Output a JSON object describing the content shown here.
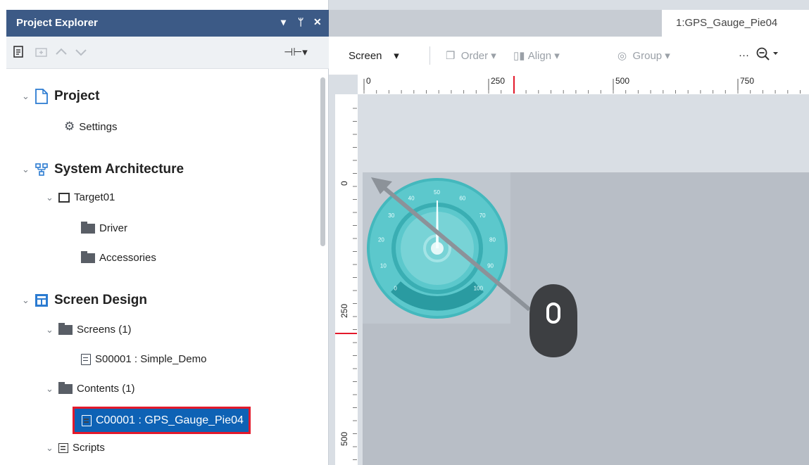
{
  "explorer": {
    "title": "Project Explorer",
    "header_controls": [
      "▾",
      "ᛘ",
      "✕"
    ],
    "toolbar": {
      "pin_label": "⊣⊢▾"
    },
    "tree": {
      "project": "Project",
      "settings": "Settings",
      "system_architecture": "System Architecture",
      "target": "Target01",
      "driver": "Driver",
      "accessories": "Accessories",
      "screen_design": "Screen Design",
      "screens": "Screens (1)",
      "screen_item": "S00001 : Simple_Demo",
      "contents": "Contents (1)",
      "content_item": "C00001 : GPS_Gauge_Pie04",
      "scripts": "Scripts"
    }
  },
  "designer": {
    "tab_title": "1:GPS_Gauge_Pie04",
    "toolbar": {
      "screen": "Screen",
      "order": "Order",
      "align": "Align",
      "group": "Group",
      "more": "···"
    },
    "ruler_top": [
      "0",
      "250",
      "500",
      "750"
    ],
    "ruler_left": [
      "0",
      "250",
      "500"
    ],
    "gauge_ticks": [
      "0",
      "10",
      "20",
      "30",
      "40",
      "50",
      "60",
      "70",
      "80",
      "90",
      "100"
    ]
  },
  "colors": {
    "header_bg": "#3c5a86",
    "selection_bg": "#0e62b5",
    "highlight_border": "#e3192b",
    "gauge_teal": "#4fc0c4"
  }
}
